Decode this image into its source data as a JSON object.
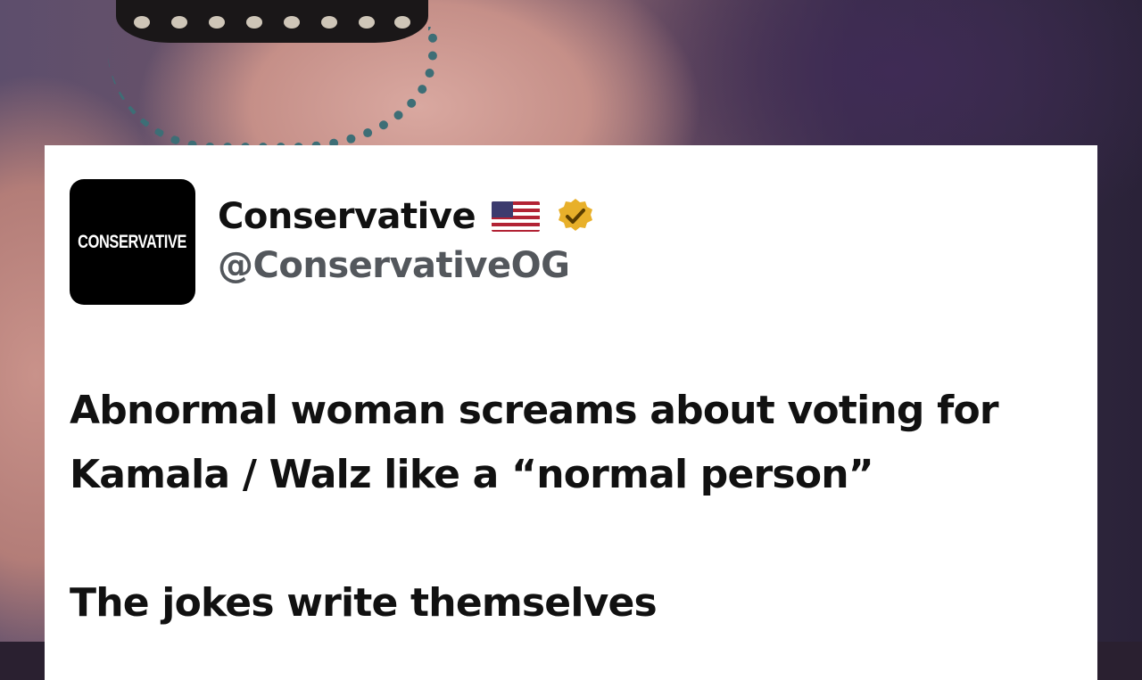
{
  "account": {
    "avatar_text": "CONSERVATIVE",
    "display_name": "Conservative",
    "flag": "us-flag-emoji",
    "verified": "gold-verified-badge",
    "handle": "@ConservativeOG"
  },
  "tweet": {
    "line1": "Abnormal woman screams about voting for",
    "line2": "Kamala / Walz like a “normal person”",
    "line3": "The jokes write themselves"
  },
  "colors": {
    "verified_badge": "#e8b02a",
    "handle": "#53575c",
    "text": "#111111"
  }
}
